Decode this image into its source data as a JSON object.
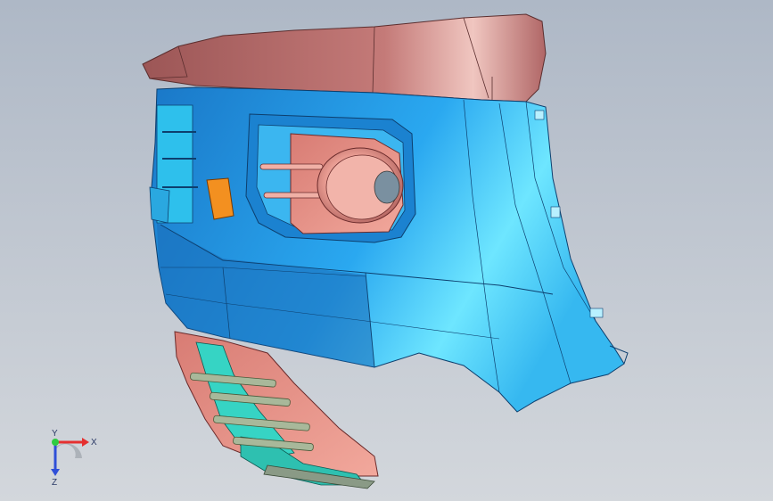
{
  "viewport": {
    "colors": {
      "body_blue": "#1e90e0",
      "body_light": "#4fd0ff",
      "cap_red": "#b86a6a",
      "salmon": "#e38f86",
      "teal": "#37d0c0",
      "amber": "#f08a1e"
    },
    "triad": {
      "x_label": "X",
      "y_label": "Y",
      "z_label": "Z",
      "x_color": "#e53030",
      "y_color": "#2ecc40",
      "z_color": "#2f4fd8"
    }
  }
}
